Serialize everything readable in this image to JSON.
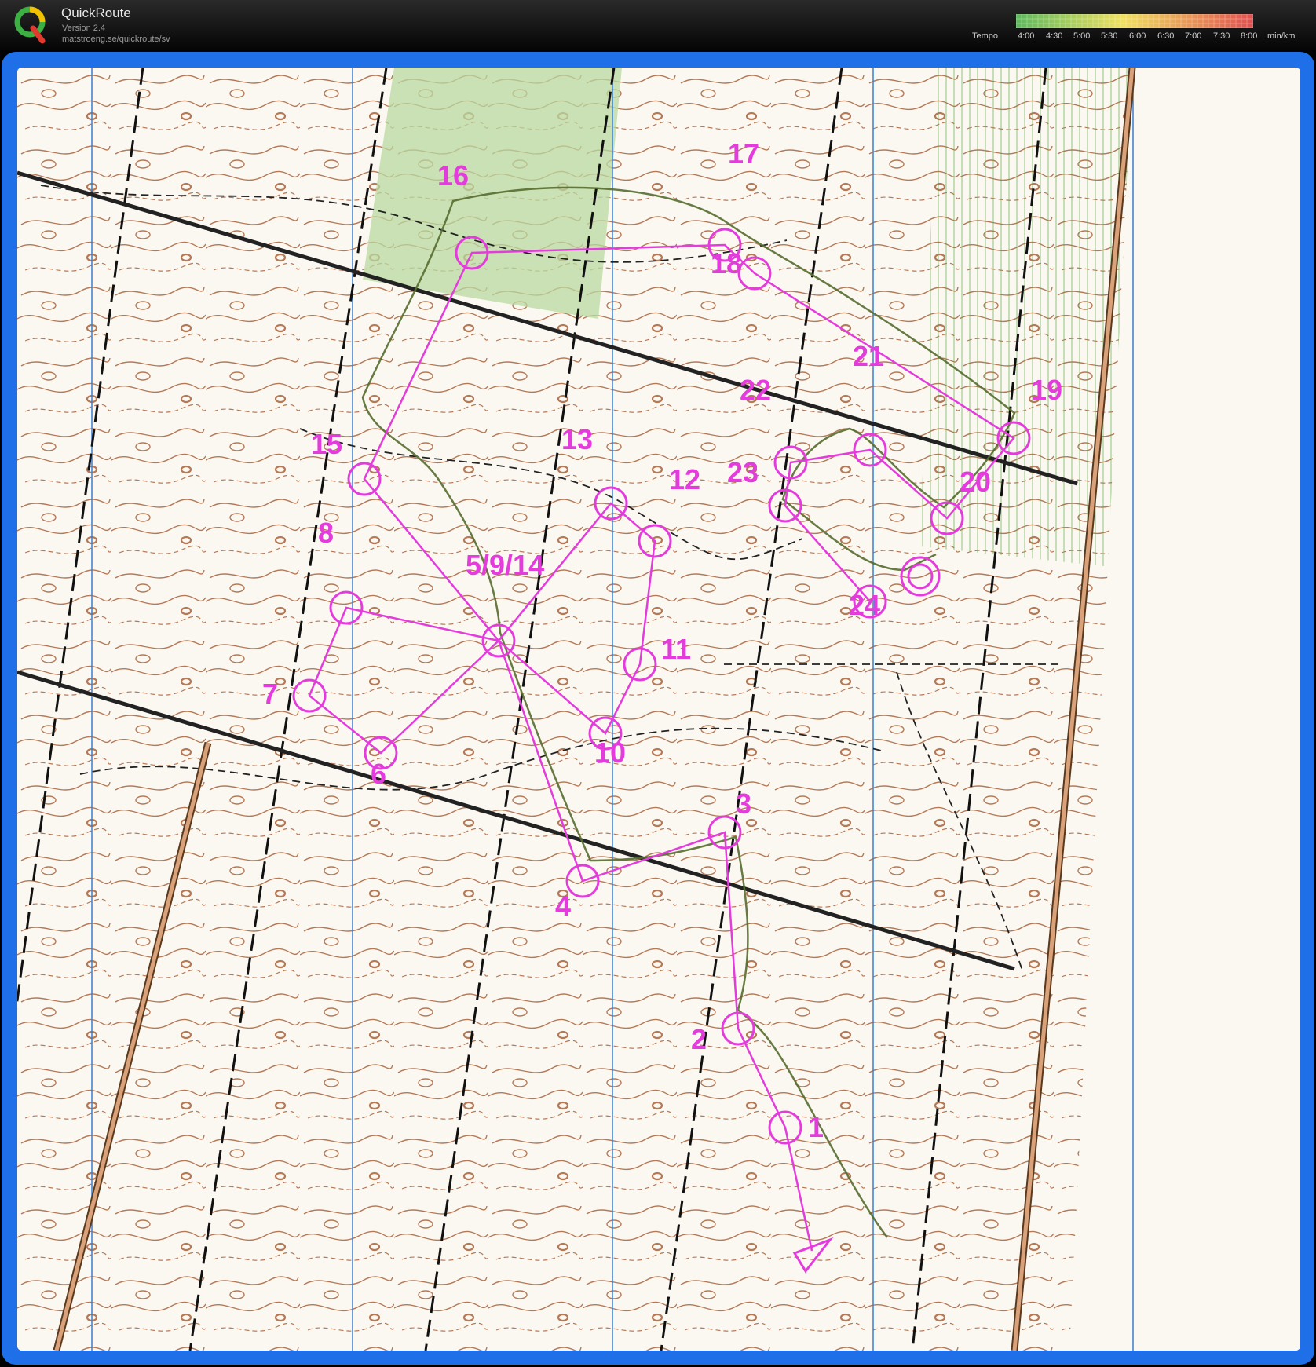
{
  "app": {
    "title": "QuickRoute",
    "version": "Version 2.4",
    "url": "matstroeng.se/quickroute/sv"
  },
  "tempo": {
    "label": "Tempo",
    "ticks": [
      "4:00",
      "4:30",
      "5:00",
      "5:30",
      "6:00",
      "6:30",
      "7:00",
      "7:30",
      "8:00",
      "min/km"
    ]
  },
  "colors": {
    "frame": "#1f6fe8",
    "course": "#e43cdc",
    "contour": "#9a5a35",
    "route": "#556b2f",
    "vegetation": "#b9d9a0",
    "tempo_start": "#5cb85c",
    "tempo_mid": "#f0e060",
    "tempo_end": "#e05050"
  },
  "icons": {
    "logo": "quickroute-q-logo",
    "start": "start-triangle",
    "finish": "finish-double-circle"
  },
  "course": {
    "controls": [
      {
        "number": "1"
      },
      {
        "number": "2"
      },
      {
        "number": "3"
      },
      {
        "number": "4"
      },
      {
        "number": "5/9/14"
      },
      {
        "number": "6"
      },
      {
        "number": "7"
      },
      {
        "number": "8"
      },
      {
        "number": "10"
      },
      {
        "number": "11"
      },
      {
        "number": "12"
      },
      {
        "number": "13"
      },
      {
        "number": "15"
      },
      {
        "number": "16"
      },
      {
        "number": "17"
      },
      {
        "number": "18"
      },
      {
        "number": "19"
      },
      {
        "number": "20"
      },
      {
        "number": "21"
      },
      {
        "number": "22"
      },
      {
        "number": "23"
      },
      {
        "number": "24"
      }
    ]
  }
}
